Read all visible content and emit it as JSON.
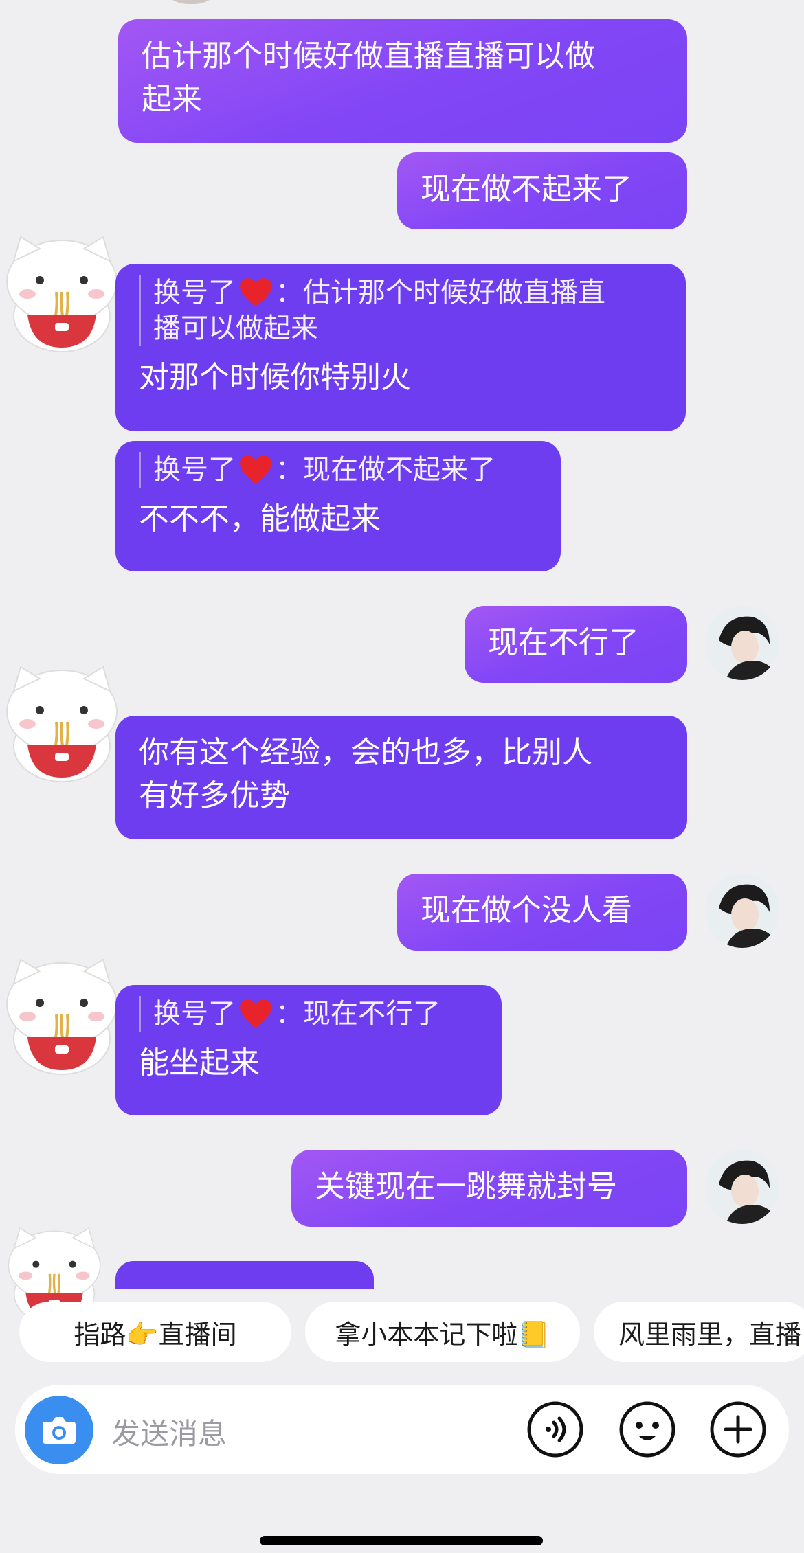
{
  "messages": [
    {
      "text_lines": [
        "估计那个时候好做直播直播可以做",
        "起来"
      ]
    },
    {
      "text": "现在做不起来了"
    },
    {
      "quote_name": "换号了",
      "quote_lines": [
        "估计那个时候好做直播直",
        "播可以做起来"
      ],
      "text": "对那个时候你特别火"
    },
    {
      "quote_name": "换号了",
      "quote_text": "现在做不起来了",
      "text": "不不不，能做起来"
    },
    {
      "text": "现在不行了"
    },
    {
      "text_lines": [
        "你有这个经验，会的也多，比别人",
        "有好多优势"
      ]
    },
    {
      "text": "现在做个没人看"
    },
    {
      "quote_name": "换号了",
      "quote_text": "现在不行了",
      "text": "能坐起来"
    },
    {
      "text": "关键现在一跳舞就封号"
    }
  ],
  "quick_replies": [
    "指路👉直播间",
    "拿小本本记下啦📒",
    "风里雨里，直播"
  ],
  "input": {
    "placeholder": "发送消息"
  },
  "colors": {
    "outgoing": "#8a4bf5",
    "incoming": "#6e3df0",
    "background": "#efeff1",
    "camera": "#3a8ef0"
  },
  "icons": [
    "camera-icon",
    "voice-icon",
    "emoji-icon",
    "plus-icon",
    "heart-icon"
  ]
}
